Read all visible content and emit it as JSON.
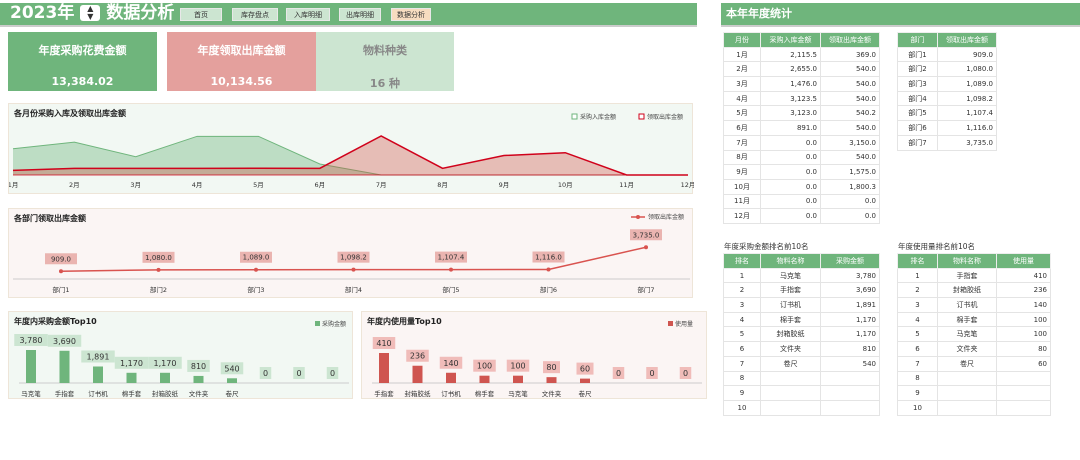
{
  "header": {
    "year": "2023年",
    "title": "数据分析",
    "nav": [
      {
        "label": "首页",
        "active": false
      },
      {
        "label": "库存盘点",
        "active": false
      },
      {
        "label": "入库明细",
        "active": false
      },
      {
        "label": "出库明细",
        "active": false
      },
      {
        "label": "数据分析",
        "active": true
      }
    ]
  },
  "cards": [
    {
      "label": "年度采购花费金额",
      "value": "13,384.02",
      "color": "#6fb57c"
    },
    {
      "label": "年度领取出库金额",
      "value": "10,134.56",
      "color": "#e4a09d"
    },
    {
      "label": "物料种类",
      "value": "16 种",
      "color": "#cce5d1"
    }
  ],
  "right_title": "本年年度统计",
  "colors": {
    "green": "#6fb57c",
    "red": "#d0021b",
    "bar_red": "#cf5550"
  },
  "monthly_table": {
    "headers": [
      "月份",
      "采购入库金额",
      "领取出库金额"
    ],
    "rows": [
      [
        "1月",
        "2,115.5",
        "369.0"
      ],
      [
        "2月",
        "2,655.0",
        "540.0"
      ],
      [
        "3月",
        "1,476.0",
        "540.0"
      ],
      [
        "4月",
        "3,123.5",
        "540.0"
      ],
      [
        "5月",
        "3,123.0",
        "540.2"
      ],
      [
        "6月",
        "891.0",
        "540.0"
      ],
      [
        "7月",
        "0.0",
        "3,150.0"
      ],
      [
        "8月",
        "0.0",
        "540.0"
      ],
      [
        "9月",
        "0.0",
        "1,575.0"
      ],
      [
        "10月",
        "0.0",
        "1,800.3"
      ],
      [
        "11月",
        "0.0",
        "0.0"
      ],
      [
        "12月",
        "0.0",
        "0.0"
      ]
    ]
  },
  "dept_table": {
    "headers": [
      "部门",
      "领取出库金额"
    ],
    "rows": [
      [
        "部门1",
        "909.0"
      ],
      [
        "部门2",
        "1,080.0"
      ],
      [
        "部门3",
        "1,089.0"
      ],
      [
        "部门4",
        "1,098.2"
      ],
      [
        "部门5",
        "1,107.4"
      ],
      [
        "部门6",
        "1,116.0"
      ],
      [
        "部门7",
        "3,735.0"
      ]
    ]
  },
  "purchase_rank": {
    "title": "年度采购金额排名前10名",
    "headers": [
      "排名",
      "物料名称",
      "采购金额"
    ],
    "rows": [
      [
        "1",
        "马克笔",
        "3,780"
      ],
      [
        "2",
        "手指套",
        "3,690"
      ],
      [
        "3",
        "订书机",
        "1,891"
      ],
      [
        "4",
        "棉手套",
        "1,170"
      ],
      [
        "5",
        "封箱胶纸",
        "1,170"
      ],
      [
        "6",
        "文件夹",
        "810"
      ],
      [
        "7",
        "卷尺",
        "540"
      ],
      [
        "8",
        "",
        ""
      ],
      [
        "9",
        "",
        ""
      ],
      [
        "10",
        "",
        ""
      ]
    ]
  },
  "usage_rank": {
    "title": "年度使用量排名前10名",
    "headers": [
      "排名",
      "物料名称",
      "使用量"
    ],
    "rows": [
      [
        "1",
        "手指套",
        "410"
      ],
      [
        "2",
        "封箱胶纸",
        "236"
      ],
      [
        "3",
        "订书机",
        "140"
      ],
      [
        "4",
        "棉手套",
        "100"
      ],
      [
        "5",
        "马克笔",
        "100"
      ],
      [
        "6",
        "文件夹",
        "80"
      ],
      [
        "7",
        "卷尺",
        "60"
      ],
      [
        "8",
        "",
        ""
      ],
      [
        "9",
        "",
        ""
      ],
      [
        "10",
        "",
        ""
      ]
    ]
  },
  "chart_data": [
    {
      "type": "area",
      "title": "各月份采购入库及领取出库金额",
      "categories": [
        "1月",
        "2月",
        "3月",
        "4月",
        "5月",
        "6月",
        "7月",
        "8月",
        "9月",
        "10月",
        "11月",
        "12月"
      ],
      "series": [
        {
          "name": "采购入库金额",
          "values": [
            2115.5,
            2655,
            1476,
            3123.5,
            3123,
            891,
            0,
            0,
            0,
            0,
            0,
            0
          ]
        },
        {
          "name": "领取出库金额",
          "values": [
            369,
            540,
            540,
            540,
            540.2,
            540,
            3150,
            540,
            1575,
            1800.3,
            0,
            0
          ]
        }
      ],
      "legend": "top-right"
    },
    {
      "type": "line",
      "title": "各部门领取出库金额",
      "categories": [
        "部门1",
        "部门2",
        "部门3",
        "部门4",
        "部门5",
        "部门6",
        "部门7"
      ],
      "series": [
        {
          "name": "领取出库金额",
          "values": [
            909,
            1080,
            1089,
            1098.2,
            1107.4,
            1116,
            3735
          ]
        }
      ],
      "labels": [
        "909.0",
        "1,080.0",
        "1,089.0",
        "1,098.2",
        "1,107.4",
        "1,116.0",
        "3,735.0"
      ],
      "legend": "top-right"
    },
    {
      "type": "bar",
      "title": "年度内采购金额Top10",
      "categories": [
        "马克笔",
        "手指套",
        "订书机",
        "棉手套",
        "封箱胶纸",
        "文件夹",
        "卷尺",
        "",
        "",
        ""
      ],
      "series": [
        {
          "name": "采购金额",
          "values": [
            3780,
            3690,
            1891,
            1170,
            1170,
            810,
            540,
            0,
            0,
            0
          ]
        }
      ],
      "labels": [
        "3,780",
        "3,690",
        "1,891",
        "1,170",
        "1,170",
        "810",
        "540",
        "0",
        "0",
        "0"
      ],
      "legend": "top-right"
    },
    {
      "type": "bar",
      "title": "年度内使用量Top10",
      "categories": [
        "手指套",
        "封箱胶纸",
        "订书机",
        "棉手套",
        "马克笔",
        "文件夹",
        "卷尺",
        "",
        "",
        ""
      ],
      "series": [
        {
          "name": "使用量",
          "values": [
            410,
            236,
            140,
            100,
            100,
            80,
            60,
            0,
            0,
            0
          ]
        }
      ],
      "labels": [
        "410",
        "236",
        "140",
        "100",
        "100",
        "80",
        "60",
        "0",
        "0",
        "0"
      ],
      "legend": "top-right"
    }
  ]
}
